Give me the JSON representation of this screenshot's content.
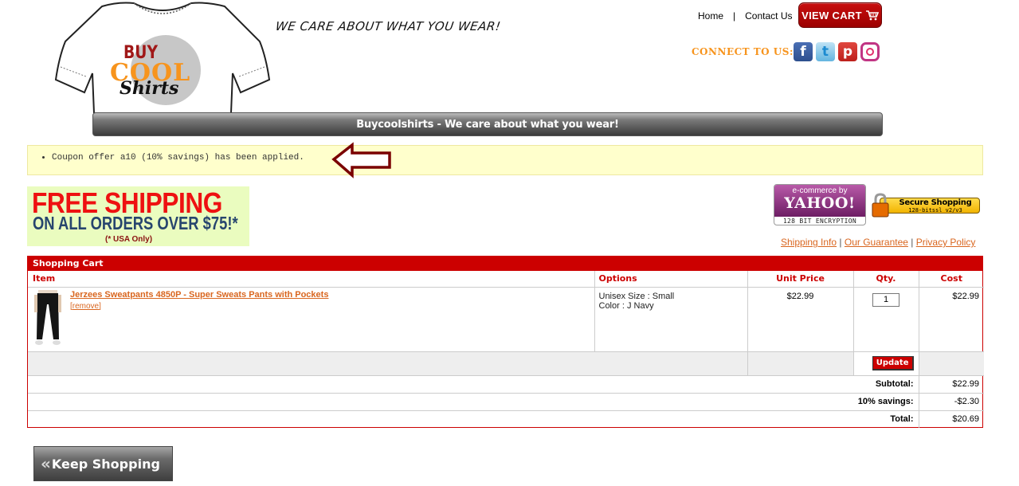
{
  "header": {
    "logo": {
      "line1": "BUY",
      "line2": "COOL",
      "line3": "Shirts"
    },
    "tagline": "WE CARE ABOUT WHAT YOU WEAR!",
    "nav": {
      "home": "Home",
      "separator": "|",
      "contact": "Contact Us"
    },
    "view_cart": "VIEW CART",
    "connect_label": "CONNECT TO US:",
    "social": [
      {
        "name": "facebook",
        "glyph": "f"
      },
      {
        "name": "twitter",
        "glyph": "t"
      },
      {
        "name": "pinterest",
        "glyph": "p"
      },
      {
        "name": "instagram",
        "glyph": ""
      }
    ],
    "banner": "Buycoolshirts - We care about what you wear!"
  },
  "notice": {
    "message": "Coupon offer a10 (10% savings) has been applied.",
    "arrow_color": "#7a0000"
  },
  "promo": {
    "line1": "FREE SHIPPING",
    "line2": "ON ALL ORDERS OVER $75!*",
    "line3": "(* USA Only)"
  },
  "badges": {
    "yahoo": {
      "top": "e-commerce by",
      "brand": "YAHOO!",
      "bottom": "128 BIT ENCRYPTION"
    },
    "secure": {
      "title": "Secure Shopping",
      "sub": "128-bitssl v2/v3"
    }
  },
  "links": {
    "shipping": "Shipping Info",
    "guarantee": "Our Guarantee",
    "privacy": "Privacy Policy",
    "separator": "|"
  },
  "cart": {
    "title": "Shopping Cart",
    "columns": {
      "item": "Item",
      "options": "Options",
      "unit_price": "Unit Price",
      "qty": "Qty.",
      "cost": "Cost"
    },
    "items": [
      {
        "name": "Jerzees Sweatpants 4850P - Super Sweats Pants with Pockets",
        "remove": "[remove]",
        "options": [
          "Unisex Size : Small",
          "Color : J Navy"
        ],
        "unit_price": "$22.99",
        "qty": "1",
        "cost": "$22.99"
      }
    ],
    "update_label": "Update",
    "totals": [
      {
        "label": "Subtotal:",
        "value": "$22.99"
      },
      {
        "label": "10% savings:",
        "value": "-$2.30"
      },
      {
        "label": "Total:",
        "value": "$20.69"
      }
    ],
    "accent": "#cc0000"
  },
  "keep_shopping": {
    "chevron": "«",
    "label": "Keep Shopping"
  }
}
